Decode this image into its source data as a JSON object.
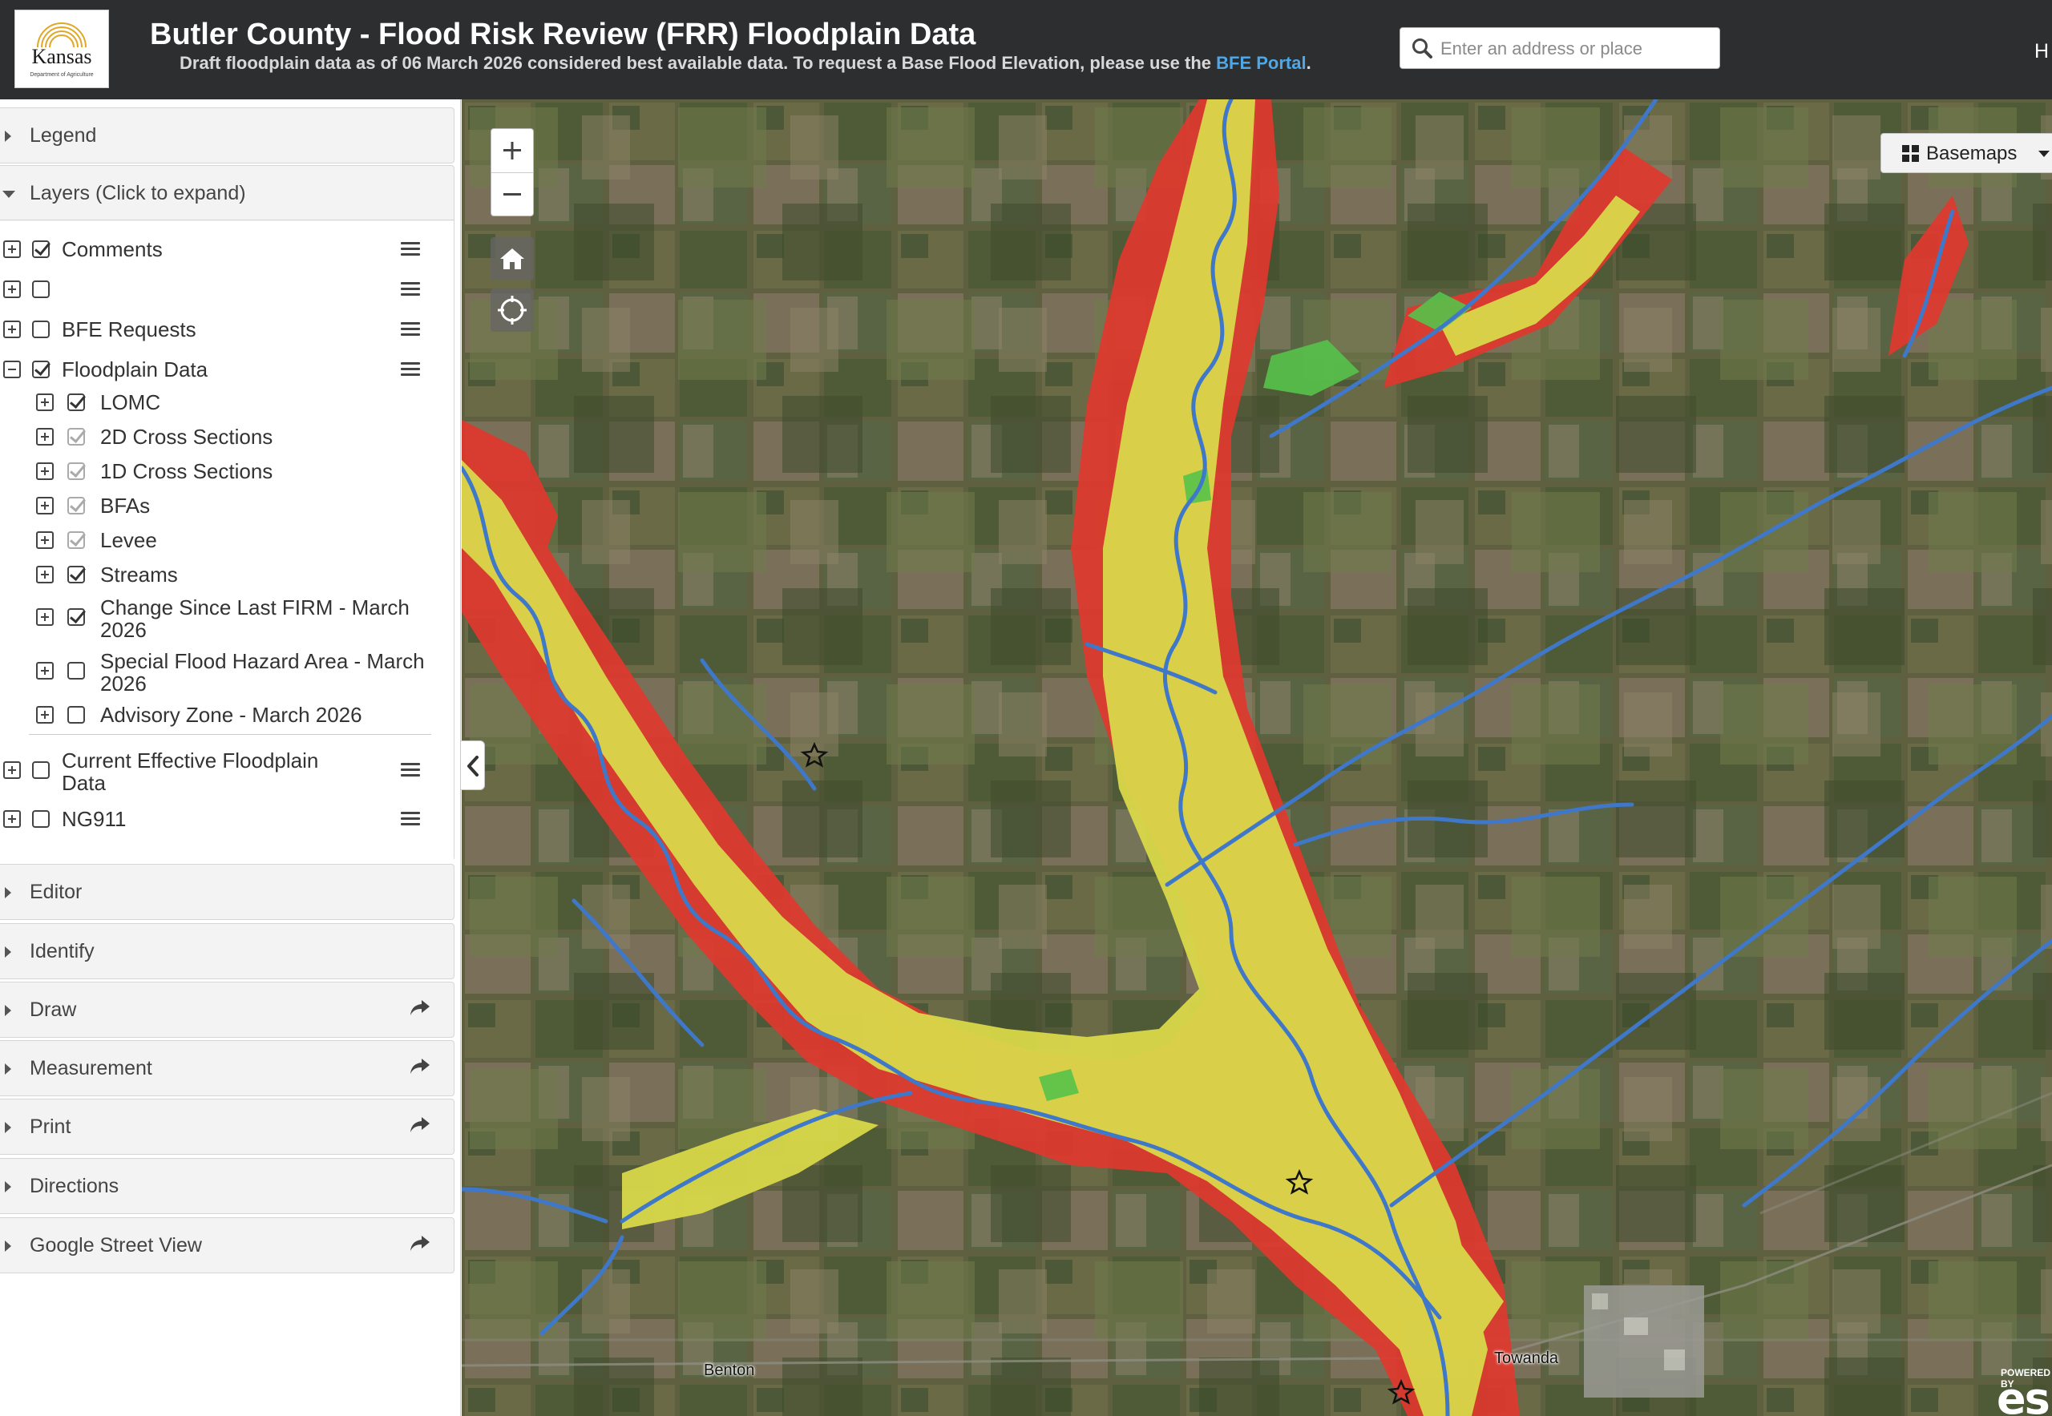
{
  "header": {
    "title": "Butler County - Flood Risk Review (FRR) Floodplain Data",
    "subtitle_text": "Draft floodplain data as of 06 March 2026 considered best available data. To request a Base Flood Elevation, please use the",
    "subtitle_link": "BFE Portal",
    "subtitle_end": ".",
    "overflow_text": "H",
    "logo_text": "Kansas",
    "logo_subtext": "Department of Agriculture"
  },
  "search": {
    "placeholder": "Enter an address or place",
    "value": ""
  },
  "sidebar": {
    "panels": {
      "legend": "Legend",
      "layers": "Layers (Click to expand)",
      "editor": "Editor",
      "identify": "Identify",
      "draw": "Draw",
      "measurement": "Measurement",
      "print": "Print",
      "directions": "Directions",
      "street_view": "Google Street View"
    },
    "layers": [
      {
        "name": "Comments",
        "checked": true
      },
      {
        "name": "",
        "checked": false
      },
      {
        "name": "BFE Requests",
        "checked": false
      },
      {
        "name": "Floodplain Data",
        "checked": true,
        "expanded": true,
        "sublayers": [
          {
            "name": "LOMC",
            "checked": true
          },
          {
            "name": "2D Cross Sections",
            "checked": true,
            "dimmed": true
          },
          {
            "name": "1D Cross Sections",
            "checked": true,
            "dimmed": true
          },
          {
            "name": "BFAs",
            "checked": true,
            "dimmed": true
          },
          {
            "name": "Levee",
            "checked": true,
            "dimmed": true
          },
          {
            "name": "Streams",
            "checked": true
          },
          {
            "name": "Change Since Last FIRM - March 2026",
            "checked": true
          },
          {
            "name": "Special Flood Hazard Area - March 2026",
            "checked": false
          },
          {
            "name": "Advisory Zone - March 2026",
            "checked": false
          }
        ]
      },
      {
        "name": "Current Effective Floodplain Data",
        "checked": false
      },
      {
        "name": "NG911",
        "checked": false
      }
    ]
  },
  "map": {
    "zoom_in": "+",
    "zoom_out": "−",
    "basemaps_label": "Basemaps",
    "places": [
      "Benton",
      "Towanda"
    ],
    "powered_by": "POWERED BY",
    "esri": "esri"
  },
  "colors": {
    "header_bg": "#2d2e30",
    "link": "#4ea8e8",
    "flood_red": "#e0382e",
    "flood_yellow": "#d9d84a",
    "stream_blue": "#3f78c8",
    "change_green": "#56c24a"
  },
  "icons": {
    "search": "search-icon",
    "home": "home-icon",
    "locate": "locate-icon",
    "basemaps": "grid-icon",
    "collapse": "chevron-left-icon",
    "share": "share-arrow-icon",
    "layer_menu": "menu-icon"
  }
}
